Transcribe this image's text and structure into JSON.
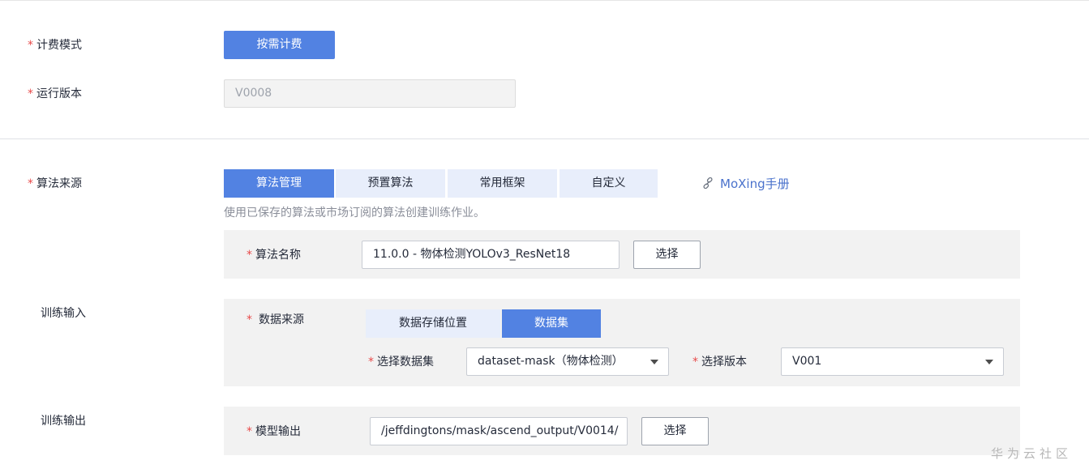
{
  "billing": {
    "label": "计费模式",
    "button": "按需计费"
  },
  "runtime": {
    "label": "运行版本",
    "value": "V0008"
  },
  "algorithm_source": {
    "label": "算法来源",
    "tabs": [
      "算法管理",
      "预置算法",
      "常用框架",
      "自定义"
    ],
    "active_tab": "算法管理",
    "link_icon": "link-icon",
    "link_text": "MoXing手册",
    "hint": "使用已保存的算法或市场订阅的算法创建训练作业。"
  },
  "algorithm_name": {
    "label": "算法名称",
    "value": "11.0.0 - 物体检测YOLOv3_ResNet18",
    "select_button": "选择"
  },
  "training_input": {
    "label": "训练输入",
    "data_source_label": "数据来源",
    "source_tabs": [
      "数据存储位置",
      "数据集"
    ],
    "active_source_tab": "数据集",
    "dataset_label": "选择数据集",
    "dataset_value": "dataset-mask（物体检测）",
    "version_label": "选择版本",
    "version_value": "V001"
  },
  "training_output": {
    "label": "训练输出",
    "model_output_label": "模型输出",
    "model_output_value": "/jeffdingtons/mask/ascend_output/V0014/",
    "select_button": "选择"
  },
  "watermark": "华为云社区",
  "colors": {
    "primary": "#5282e2",
    "required_star": "#e84a4a",
    "tab_inactive": "#e8eefb",
    "panel": "#f2f2f2"
  }
}
